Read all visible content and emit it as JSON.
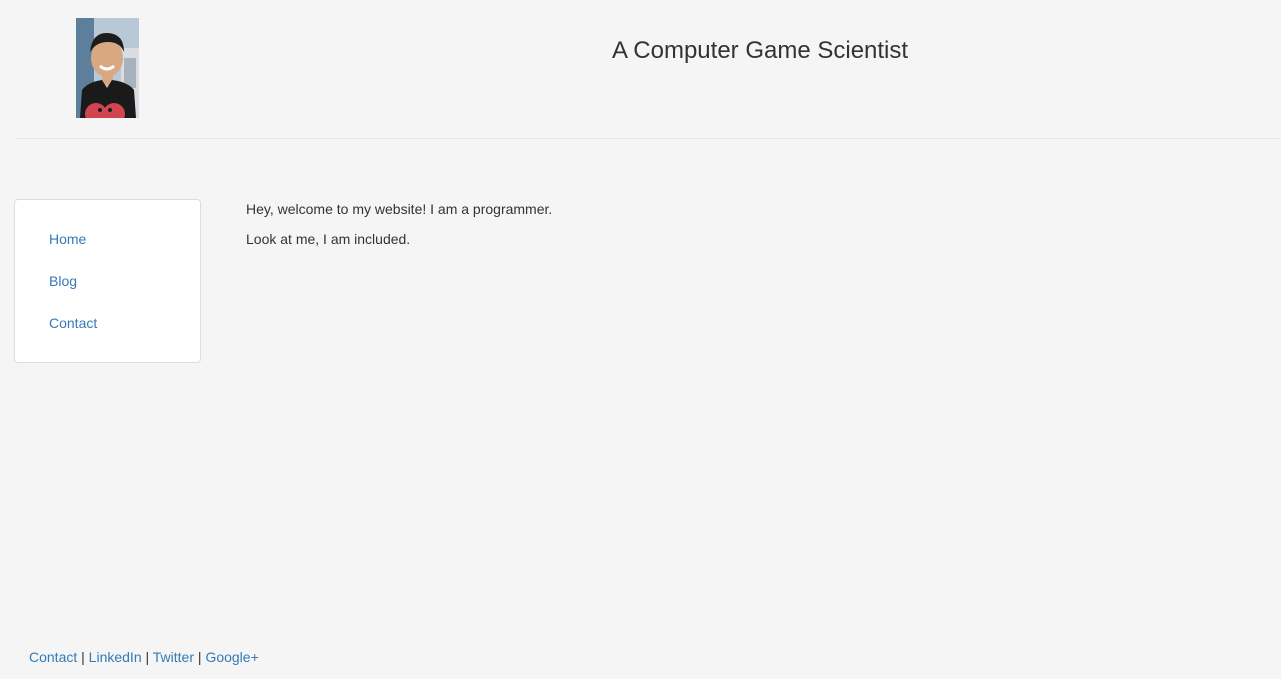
{
  "header": {
    "site_title": "A Computer Game Scientist"
  },
  "sidebar": {
    "items": [
      {
        "label": "Home"
      },
      {
        "label": "Blog"
      },
      {
        "label": "Contact"
      }
    ]
  },
  "main": {
    "paragraphs": [
      "Hey, welcome to my website! I am a programmer.",
      "Look at me, I am included."
    ]
  },
  "footer": {
    "links": [
      {
        "label": "Contact"
      },
      {
        "label": "LinkedIn"
      },
      {
        "label": "Twitter"
      },
      {
        "label": "Google+"
      }
    ],
    "separator": "|"
  },
  "colors": {
    "background": "#f5f5f5",
    "link": "#337ab7",
    "text": "#333333"
  }
}
